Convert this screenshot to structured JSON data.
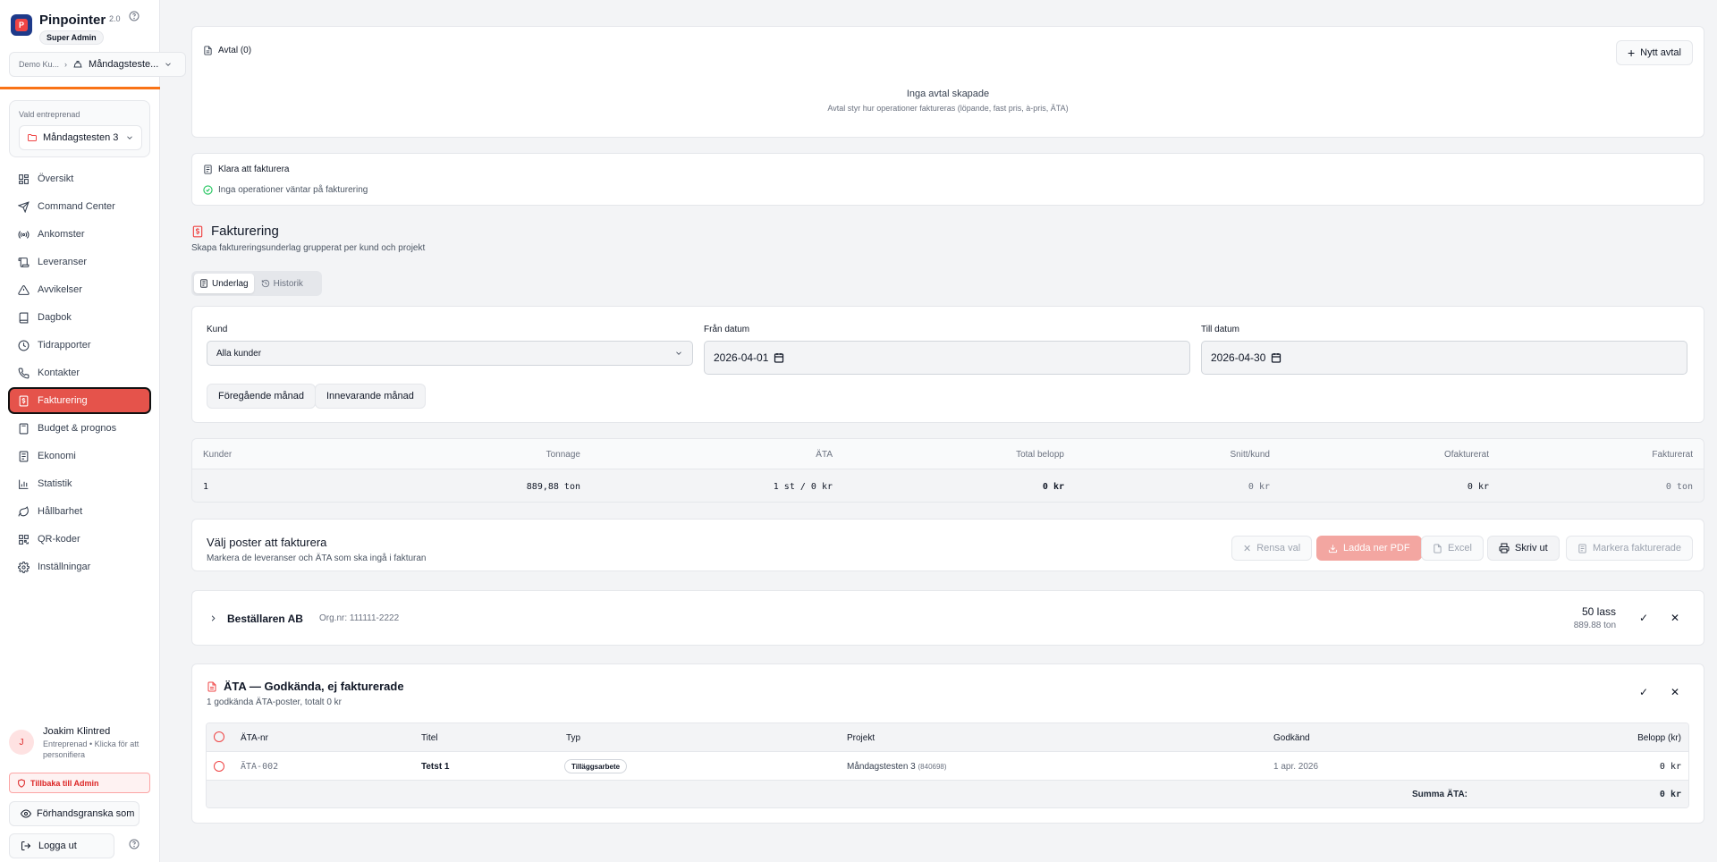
{
  "app": {
    "name": "Pinpointer",
    "version": "2.0",
    "role": "Super Admin"
  },
  "switcher": {
    "tenant": "Demo Ku...",
    "project": "Måndagsteste..."
  },
  "selected_contract": {
    "label": "Vald entreprenad",
    "value": "Måndagstesten 3"
  },
  "nav": [
    {
      "label": "Översikt",
      "icon": "grid-icon"
    },
    {
      "label": "Command Center",
      "icon": "send-icon"
    },
    {
      "label": "Ankomster",
      "icon": "radio-icon"
    },
    {
      "label": "Leveranser",
      "icon": "scroll-icon"
    },
    {
      "label": "Avvikelser",
      "icon": "warning-icon"
    },
    {
      "label": "Dagbok",
      "icon": "book-icon"
    },
    {
      "label": "Tidrapporter",
      "icon": "clock-icon"
    },
    {
      "label": "Kontakter",
      "icon": "phone-icon"
    },
    {
      "label": "Fakturering",
      "icon": "invoice-icon",
      "active": true
    },
    {
      "label": "Budget & prognos",
      "icon": "calculator-icon"
    },
    {
      "label": "Ekonomi",
      "icon": "ledger-icon"
    },
    {
      "label": "Statistik",
      "icon": "bar-chart-icon"
    },
    {
      "label": "Hållbarhet",
      "icon": "leaf-icon"
    },
    {
      "label": "QR-koder",
      "icon": "qr-icon"
    },
    {
      "label": "Inställningar",
      "icon": "gear-icon"
    }
  ],
  "user": {
    "initial": "J",
    "name": "Joakim Klintred",
    "subtitle": "Entreprenad • Klicka för att personifiera"
  },
  "footer": {
    "back_admin": "Tillbaka till Admin",
    "preview": "Förhandsgranska som",
    "logout": "Logga ut"
  },
  "contracts": {
    "title": "Avtal (0)",
    "new_button": "Nytt avtal",
    "empty_title": "Inga avtal skapade",
    "empty_sub": "Avtal styr hur operationer faktureras (löpande, fast pris, à-pris, ÄTA)"
  },
  "ready": {
    "title": "Klara att fakturera",
    "status": "Inga operationer väntar på fakturering"
  },
  "billing": {
    "title": "Fakturering",
    "subtitle": "Skapa faktureringsunderlag grupperat per kund och projekt",
    "tabs": [
      "Underlag",
      "Historik"
    ]
  },
  "filters": {
    "customer_label": "Kund",
    "customer_value": "Alla kunder",
    "from_label": "Från datum",
    "from_value": "2026-04-01",
    "to_label": "Till datum",
    "to_value": "2026-04-30",
    "prev_month": "Föregående månad",
    "current_month": "Innevarande månad"
  },
  "stats": {
    "headers": [
      "Kunder",
      "Tonnage",
      "ÄTA",
      "Total belopp",
      "Snitt/kund",
      "Ofakturerat",
      "Fakturerat"
    ],
    "values": [
      "1",
      "889,88 ton",
      "1 st / 0 kr",
      "0 kr",
      "0 kr",
      "0 kr",
      "0 ton"
    ]
  },
  "select_posts": {
    "title": "Välj poster att fakturera",
    "subtitle": "Markera de leveranser och ÄTA som ska ingå i fakturan",
    "clear": "Rensa val",
    "download_pdf": "Ladda ner PDF",
    "excel": "Excel",
    "print": "Skriv ut",
    "mark_invoiced": "Markera fakturerade"
  },
  "customer_group": {
    "name": "Beställaren AB",
    "org": "Org.nr: 111111-2222",
    "loads": "50 lass",
    "tonnage": "889.88 ton"
  },
  "ata": {
    "title": "ÄTA — Godkända, ej fakturerade",
    "subtitle": "1 godkända ÄTA-poster, totalt 0 kr",
    "headers": [
      "ÄTA-nr",
      "Titel",
      "Typ",
      "Projekt",
      "Godkänd",
      "Belopp (kr)"
    ],
    "row": {
      "nr": "ÄTA-002",
      "title": "Tetst 1",
      "type": "Tilläggsarbete",
      "project": "Måndagstesten 3",
      "project_code": "(840698)",
      "approved": "1 apr. 2026",
      "amount": "0 kr"
    },
    "sum_label": "Summa ÄTA:",
    "sum_value": "0 kr"
  },
  "colors": {
    "accent": "#e5534b",
    "brand": "#1e3a8a",
    "orange": "#f97316"
  }
}
